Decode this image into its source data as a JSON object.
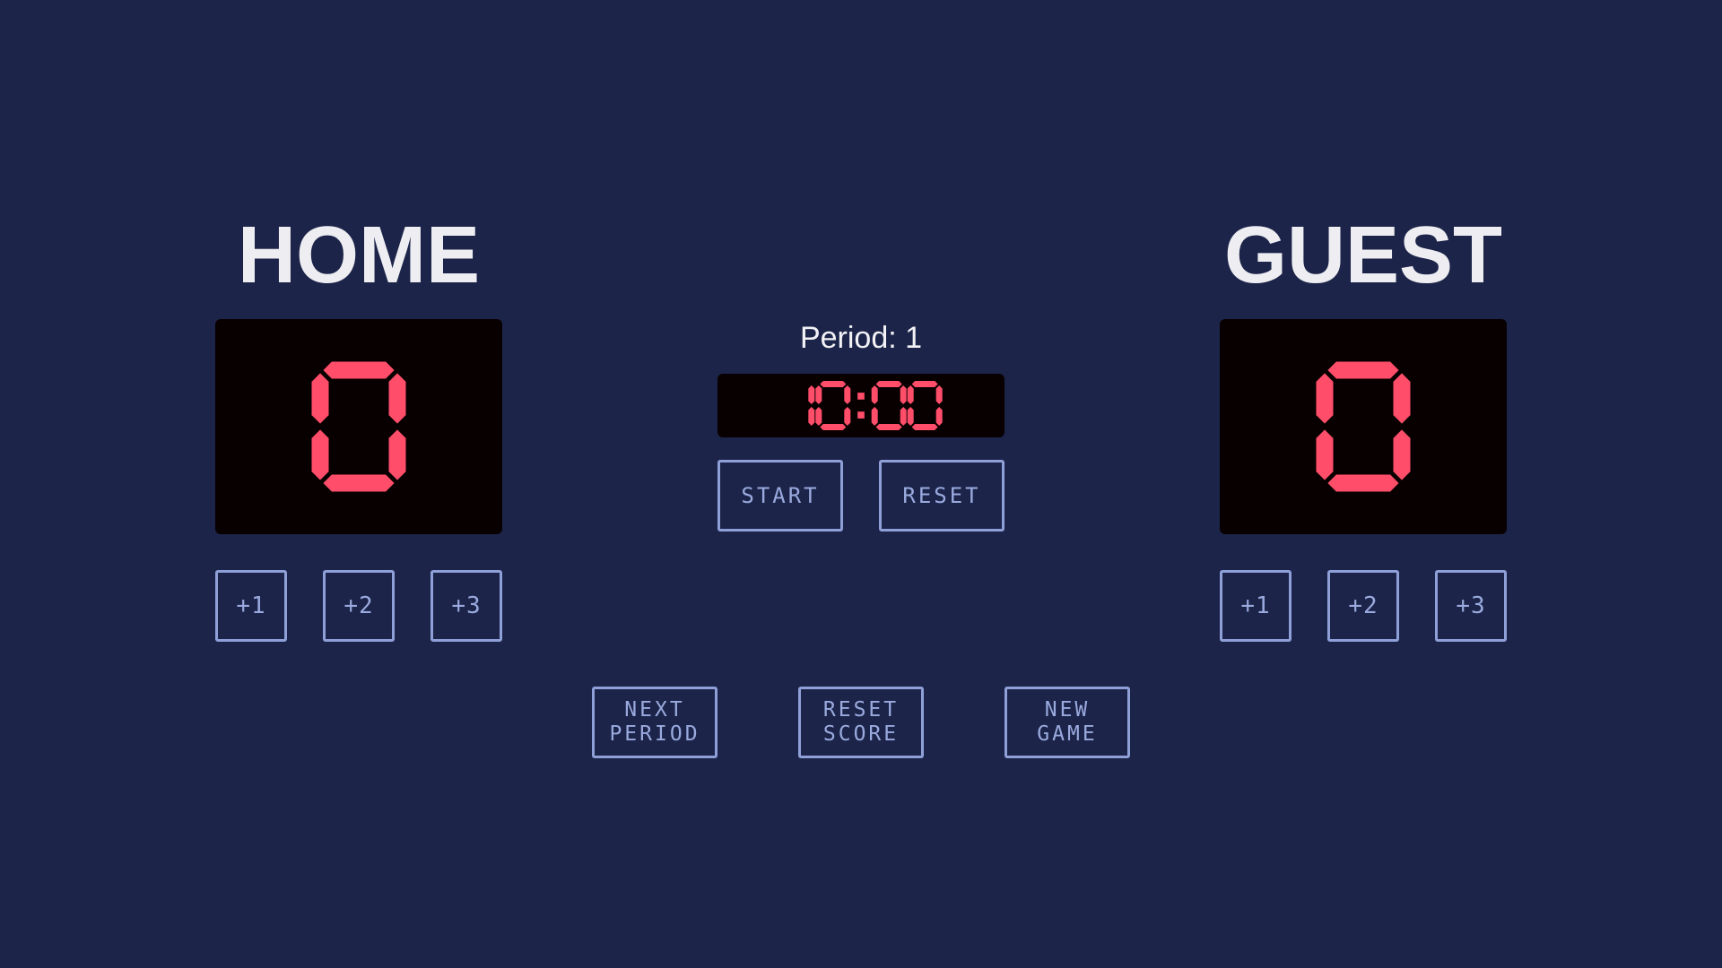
{
  "home": {
    "name": "HOME",
    "score": "0",
    "buttons": [
      "+1",
      "+2",
      "+3"
    ]
  },
  "guest": {
    "name": "GUEST",
    "score": "0",
    "buttons": [
      "+1",
      "+2",
      "+3"
    ]
  },
  "period": {
    "text": "Period: 1"
  },
  "clock": {
    "time": "10:00",
    "start_label": "START",
    "reset_label": "RESET"
  },
  "game_controls": {
    "next_period": [
      "NEXT",
      "PERIOD"
    ],
    "reset_score": [
      "RESET",
      "SCORE"
    ],
    "new_game": [
      "NEW",
      "GAME"
    ]
  },
  "colors": {
    "background": "#1c2449",
    "display_bg": "#080000",
    "segment_on": "#ff4d6a",
    "button_border": "#8fa0d8",
    "title_text": "#eeeef2"
  }
}
